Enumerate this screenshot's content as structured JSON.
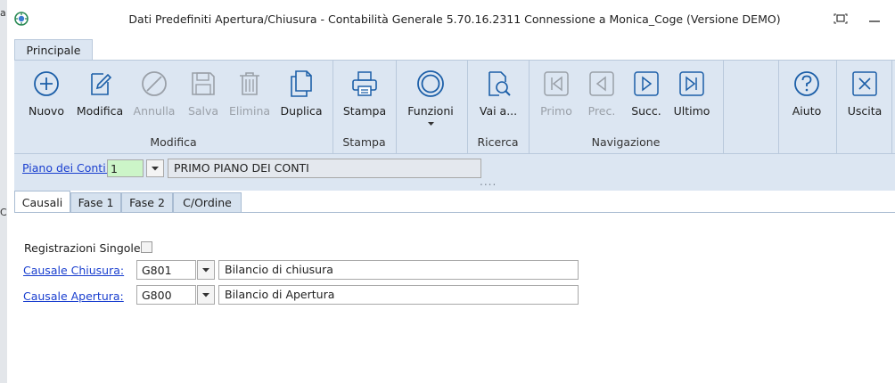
{
  "window": {
    "title": "Dati Predefiniti Apertura/Chiusura - Contabilità Generale 5.70.16.2311  Connessione a Monica_Coge (Versione DEMO)",
    "app_icon": "app-logo-icon",
    "buttons": [
      "restore-icon",
      "minimize-icon"
    ]
  },
  "left_strip_chars": [
    "a",
    "C"
  ],
  "ribbon": {
    "tab": "Principale",
    "groups": [
      {
        "name": "Modifica",
        "buttons": [
          {
            "label": "Nuovo",
            "icon": "plus-circle-icon",
            "enabled": true
          },
          {
            "label": "Modifica",
            "icon": "edit-pencil-icon",
            "enabled": true
          },
          {
            "label": "Annulla",
            "icon": "cancel-circle-icon",
            "enabled": false
          },
          {
            "label": "Salva",
            "icon": "floppy-disk-icon",
            "enabled": false
          },
          {
            "label": "Elimina",
            "icon": "trash-icon",
            "enabled": false
          },
          {
            "label": "Duplica",
            "icon": "duplicate-icon",
            "enabled": true
          }
        ]
      },
      {
        "name": "Stampa",
        "buttons": [
          {
            "label": "Stampa",
            "icon": "printer-icon",
            "enabled": true
          }
        ]
      },
      {
        "name": "",
        "buttons": [
          {
            "label": "Funzioni",
            "icon": "functions-circle-icon",
            "enabled": true
          }
        ]
      },
      {
        "name": "Ricerca",
        "buttons": [
          {
            "label": "Vai a...",
            "icon": "search-document-icon",
            "enabled": true
          }
        ]
      },
      {
        "name": "Navigazione",
        "buttons": [
          {
            "label": "Primo",
            "icon": "first-record-icon",
            "enabled": false
          },
          {
            "label": "Prec.",
            "icon": "previous-record-icon",
            "enabled": false
          },
          {
            "label": "Succ.",
            "icon": "next-record-icon",
            "enabled": true
          },
          {
            "label": "Ultimo",
            "icon": "last-record-icon",
            "enabled": true
          }
        ]
      },
      {
        "name": "",
        "buttons": [
          {
            "label": "Aiuto",
            "icon": "help-icon",
            "enabled": true
          },
          {
            "label": "Uscita",
            "icon": "exit-icon",
            "enabled": true
          }
        ]
      }
    ]
  },
  "piano": {
    "label": "Piano dei Conti:",
    "code": "1",
    "description": "PRIMO PIANO DEI CONTI",
    "grip": "...."
  },
  "tabs": [
    "Causali",
    "Fase 1",
    "Fase 2",
    "C/Ordine"
  ],
  "form": {
    "registrazioni_label": "Registrazioni Singole",
    "registrazioni_checked": false,
    "chiusura": {
      "label": "Causale Chiusura:",
      "code": "G801",
      "description": "Bilancio di chiusura"
    },
    "apertura": {
      "label": "Causale Apertura:",
      "code": "G800",
      "description": "Bilancio di Apertura"
    }
  },
  "colors": {
    "ribbon_bg": "#dce6f2",
    "icon_blue": "#1c5fa8",
    "link": "#1a3fcf",
    "code_highlight": "#ccf5c8"
  }
}
